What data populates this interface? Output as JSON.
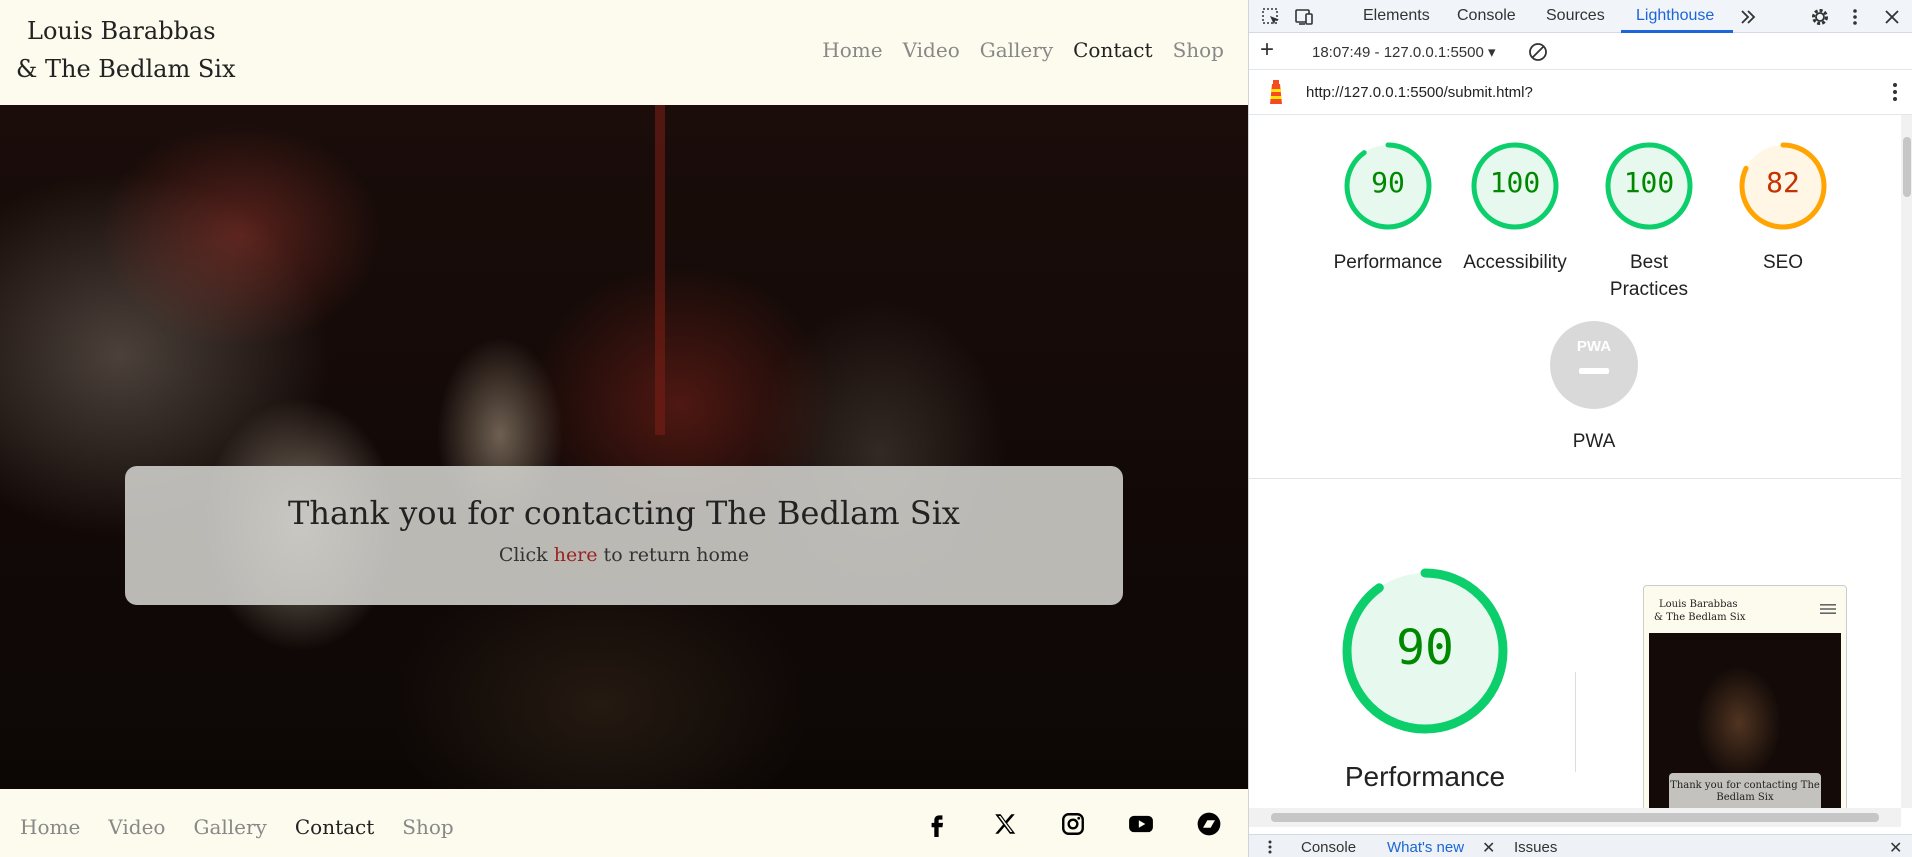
{
  "site": {
    "brand_line1": "Louis Barabbas",
    "brand_line2": "& The Bedlam Six",
    "nav": [
      {
        "label": "Home",
        "active": false
      },
      {
        "label": "Video",
        "active": false
      },
      {
        "label": "Gallery",
        "active": false
      },
      {
        "label": "Contact",
        "active": true
      },
      {
        "label": "Shop",
        "active": false
      }
    ],
    "hero": {
      "heading": "Thank you for contacting The Bedlam Six",
      "text_before": "Click ",
      "link_text": "here",
      "text_after": " to return home"
    },
    "footer_nav": [
      {
        "label": "Home",
        "active": false
      },
      {
        "label": "Video",
        "active": false
      },
      {
        "label": "Gallery",
        "active": false
      },
      {
        "label": "Contact",
        "active": true
      },
      {
        "label": "Shop",
        "active": false
      }
    ],
    "socials": [
      "facebook-icon",
      "x-twitter-icon",
      "instagram-icon",
      "youtube-icon",
      "bandcamp-icon"
    ]
  },
  "devtools": {
    "tabs": [
      {
        "label": "Elements",
        "active": false
      },
      {
        "label": "Console",
        "active": false
      },
      {
        "label": "Sources",
        "active": false
      },
      {
        "label": "Lighthouse",
        "active": true
      }
    ],
    "session": "18:07:49 - 127.0.0.1:5500 ▾",
    "url": "http://127.0.0.1:5500/submit.html?",
    "scores": [
      {
        "label": "Performance",
        "value": 90
      },
      {
        "label": "Accessibility",
        "value": 100
      },
      {
        "label": "Best Practices",
        "value": 100
      },
      {
        "label": "SEO",
        "value": 82
      }
    ],
    "pwa": {
      "badge": "PWA",
      "label": "PWA"
    },
    "main_score": {
      "label": "Performance",
      "value": 90
    },
    "thumbnail": {
      "brand_line1": "Louis Barabbas",
      "brand_line2": "& The Bedlam Six",
      "card_text": "Thank you for contacting The Bedlam Six"
    },
    "drawer": [
      {
        "label": "Console",
        "active": false
      },
      {
        "label": "What's new",
        "active": true
      },
      {
        "label": "Issues",
        "active": false
      }
    ],
    "colors": {
      "pass": "#0cce6b",
      "pass_text": "#008800",
      "average": "#ffa400",
      "average_text": "#c33300",
      "accent": "#1a66d8"
    }
  }
}
